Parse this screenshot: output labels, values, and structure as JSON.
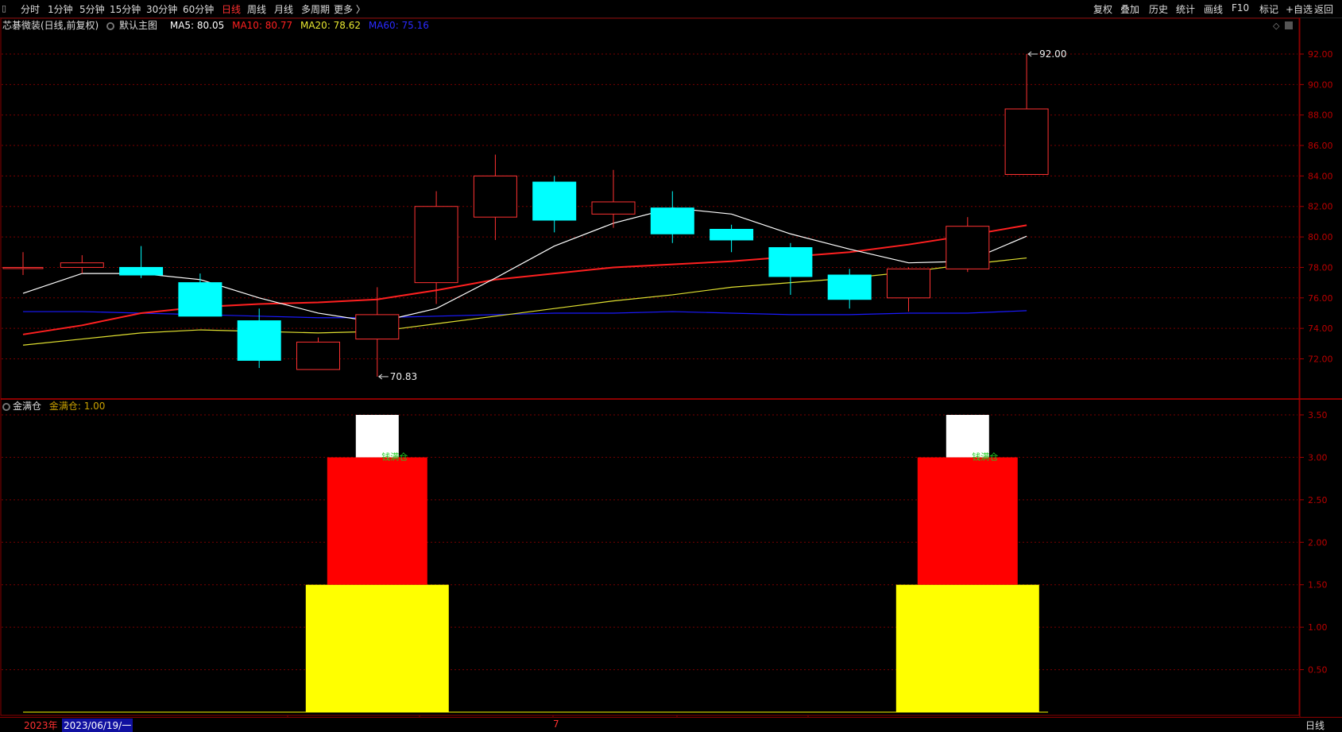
{
  "toolbar": {
    "left_items": [
      "分时",
      "1分钟",
      "5分钟",
      "15分钟",
      "30分钟",
      "60分钟",
      "日线",
      "周线",
      "月线",
      "多周期",
      "更多 〉"
    ],
    "active": "日线",
    "right_items": [
      "复权",
      "叠加",
      "历史",
      "统计",
      "画线",
      "F10",
      "标记",
      "+自选",
      "返回"
    ]
  },
  "info": {
    "stock": "芯碁微装(日线,前复权)",
    "template": "默认主图",
    "ma5": "MA5: 80.05",
    "ma10": "MA10: 80.77",
    "ma20": "MA20: 78.62",
    "ma60": "MA60: 75.16"
  },
  "sub_info": {
    "name": "金满仓",
    "value": "金满仓: 1.00"
  },
  "colors": {
    "up": "#ff3232",
    "down": "#00ffff",
    "ma5": "#ffffff",
    "ma10": "#ff2020",
    "ma20": "#e0e030",
    "ma60": "#1a1aff",
    "grid": "#7a0000"
  },
  "bottom": {
    "year": "2023年",
    "date": "2023/06/19/一",
    "month_marker": "7",
    "period": "日线"
  },
  "chart_data": [
    {
      "type": "candlestick",
      "title": "芯碁微装(日线,前复权)",
      "ylim": [
        70.2,
        93.2
      ],
      "y_ticks": [
        72,
        74,
        76,
        78,
        80,
        82,
        84,
        86,
        88,
        90,
        92
      ],
      "y_tick_labels": [
        "72.00",
        "74.00",
        "76.00",
        "78.00",
        "80.00",
        "82.00",
        "84.00",
        "86.00",
        "88.00",
        "90.00",
        "92.00"
      ],
      "candles": [
        {
          "o": 78.0,
          "c": 78.0,
          "h": 79.0,
          "l": 77.5
        },
        {
          "o": 78.0,
          "c": 78.3,
          "h": 78.8,
          "l": 77.6
        },
        {
          "o": 78.0,
          "c": 77.5,
          "h": 79.4,
          "l": 77.3
        },
        {
          "o": 77.0,
          "c": 74.8,
          "h": 77.6,
          "l": 74.8
        },
        {
          "o": 74.5,
          "c": 71.9,
          "h": 75.3,
          "l": 71.4
        },
        {
          "o": 71.3,
          "c": 73.1,
          "h": 73.4,
          "l": 71.3
        },
        {
          "o": 73.3,
          "c": 74.9,
          "h": 76.7,
          "l": 70.83
        },
        {
          "o": 77.0,
          "c": 82.0,
          "h": 83.0,
          "l": 75.6
        },
        {
          "o": 81.3,
          "c": 84.0,
          "h": 85.4,
          "l": 79.8
        },
        {
          "o": 83.6,
          "c": 81.1,
          "h": 84.0,
          "l": 80.3
        },
        {
          "o": 81.5,
          "c": 82.3,
          "h": 84.4,
          "l": 80.6
        },
        {
          "o": 81.9,
          "c": 80.2,
          "h": 83.0,
          "l": 79.6
        },
        {
          "o": 80.5,
          "c": 79.8,
          "h": 80.8,
          "l": 79.0
        },
        {
          "o": 79.3,
          "c": 77.4,
          "h": 79.6,
          "l": 76.2
        },
        {
          "o": 77.5,
          "c": 75.9,
          "h": 77.9,
          "l": 75.3
        },
        {
          "o": 76.0,
          "c": 77.9,
          "h": 78.0,
          "l": 75.1
        },
        {
          "o": 77.9,
          "c": 80.7,
          "h": 81.3,
          "l": 77.7
        },
        {
          "o": 84.1,
          "c": 88.4,
          "h": 92.0,
          "l": 84.1
        }
      ],
      "ma5": [
        76.3,
        77.6,
        77.6,
        77.2,
        76.0,
        75.0,
        74.4,
        75.3,
        77.3,
        79.4,
        80.9,
        81.9,
        81.5,
        80.2,
        79.2,
        78.3,
        78.4,
        80.05
      ],
      "ma10": [
        73.6,
        74.2,
        75.0,
        75.4,
        75.6,
        75.7,
        75.9,
        76.5,
        77.2,
        77.6,
        78.0,
        78.2,
        78.4,
        78.7,
        79.0,
        79.5,
        80.1,
        80.77
      ],
      "ma20": [
        72.9,
        73.3,
        73.7,
        73.9,
        73.8,
        73.7,
        73.8,
        74.3,
        74.8,
        75.3,
        75.8,
        76.2,
        76.7,
        77.0,
        77.3,
        77.7,
        78.2,
        78.62
      ],
      "ma60": [
        75.1,
        75.1,
        75.0,
        74.9,
        74.8,
        74.7,
        74.7,
        74.8,
        74.9,
        75.0,
        75.0,
        75.1,
        75.0,
        74.9,
        74.9,
        75.0,
        75.0,
        75.16
      ],
      "annotations": [
        {
          "label": "92.00",
          "candle_index": 17,
          "value": 92.0
        },
        {
          "label": "70.83",
          "candle_index": 6,
          "value": 70.83
        }
      ]
    },
    {
      "type": "bar",
      "title": "金满仓",
      "ylim": [
        0,
        3.5
      ],
      "y_ticks": [
        0.5,
        1.0,
        1.5,
        2.0,
        2.5,
        3.0,
        3.5
      ],
      "y_tick_labels": [
        "0.50",
        "1.00",
        "1.50",
        "2.00",
        "2.50",
        "3.00",
        "3.50"
      ],
      "signals": [
        {
          "candle_index": 6,
          "label": "钱满仓",
          "yellow": 1.5,
          "red": 3.0,
          "white": 3.5
        },
        {
          "candle_index": 16,
          "label": "钱满仓",
          "yellow": 1.5,
          "red": 3.0,
          "white": 3.5
        }
      ],
      "baseline": 0
    }
  ]
}
